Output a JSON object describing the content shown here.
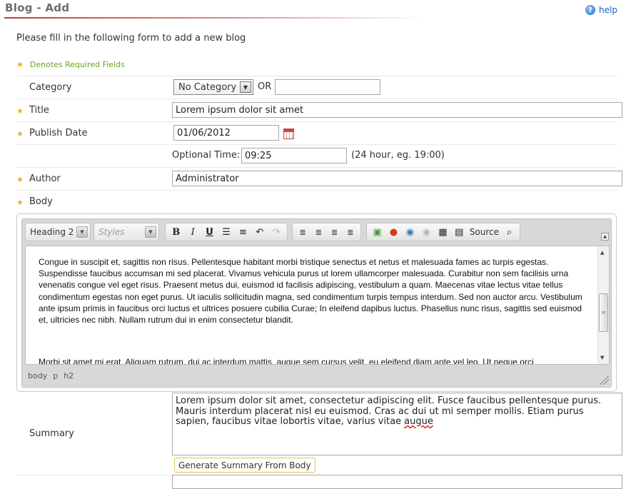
{
  "header": {
    "title": "Blog - Add",
    "help_label": "help"
  },
  "intro": "Please fill in the following form to add a new blog",
  "required_legend": "Denotes Required Fields",
  "form": {
    "category": {
      "label": "Category",
      "selected": "No Category",
      "or_label": "OR",
      "new_value": ""
    },
    "title": {
      "label": "Title",
      "value": "Lorem ipsum dolor sit amet"
    },
    "publish_date": {
      "label": "Publish Date",
      "value": "01/06/2012"
    },
    "optional_time": {
      "label": "Optional Time:",
      "value": "09:25",
      "hint": "(24 hour, eg. 19:00)"
    },
    "author": {
      "label": "Author",
      "value": "Administrator"
    },
    "body": {
      "label": "Body"
    },
    "summary": {
      "label": "Summary",
      "text_main": "Lorem ipsum dolor sit amet, consectetur adipiscing elit. Fusce faucibus pellentesque purus. Mauris interdum placerat nisl eu euismod. Cras ac dui ut mi semper mollis. Etiam purus sapien, faucibus vitae lobortis vitae, varius vitae ",
      "text_misspelled": "augue",
      "generate_button": "Generate Summary From Body"
    }
  },
  "editor": {
    "format_combo": "Heading 2",
    "styles_combo": "Styles",
    "toolbar": {
      "bold": "B",
      "italic": "I",
      "underline": "U",
      "source_label": "Source"
    },
    "content_paragraph": "Congue in suscipit et, sagittis non risus. Pellentesque habitant morbi tristique senectus et netus et malesuada fames ac turpis egestas. Suspendisse faucibus accumsan mi sed placerat. Vivamus vehicula purus ut lorem ullamcorper malesuada. Curabitur non sem facilisis urna venenatis congue vel eget risus. Praesent metus dui, euismod id facilisis adipiscing, vestibulum a quam. Maecenas vitae lectus vitae tellus condimentum egestas non eget purus. Ut iaculis sollicitudin magna, sed condimentum turpis tempus interdum. Sed non auctor arcu. Vestibulum ante ipsum primis in faucibus orci luctus et ultrices posuere cubilia Curae; In eleifend dapibus luctus. Phasellus nunc risus, sagittis sed euismod et, ultricies nec nibh. Nullam rutrum dui in enim consectetur blandit.",
    "content_partial": "Morbi sit amet mi erat. Aliquam rutrum, dui ac interdum mattis, augue sem cursus velit, eu eleifend diam ante vel leo. Ut neque orci",
    "path": [
      "body",
      "p",
      "h2"
    ]
  },
  "colors": {
    "required_star": "#e2b41b",
    "legend_text": "#6ea31e",
    "title_rule": "#c23b3b",
    "link": "#1a62b4"
  }
}
